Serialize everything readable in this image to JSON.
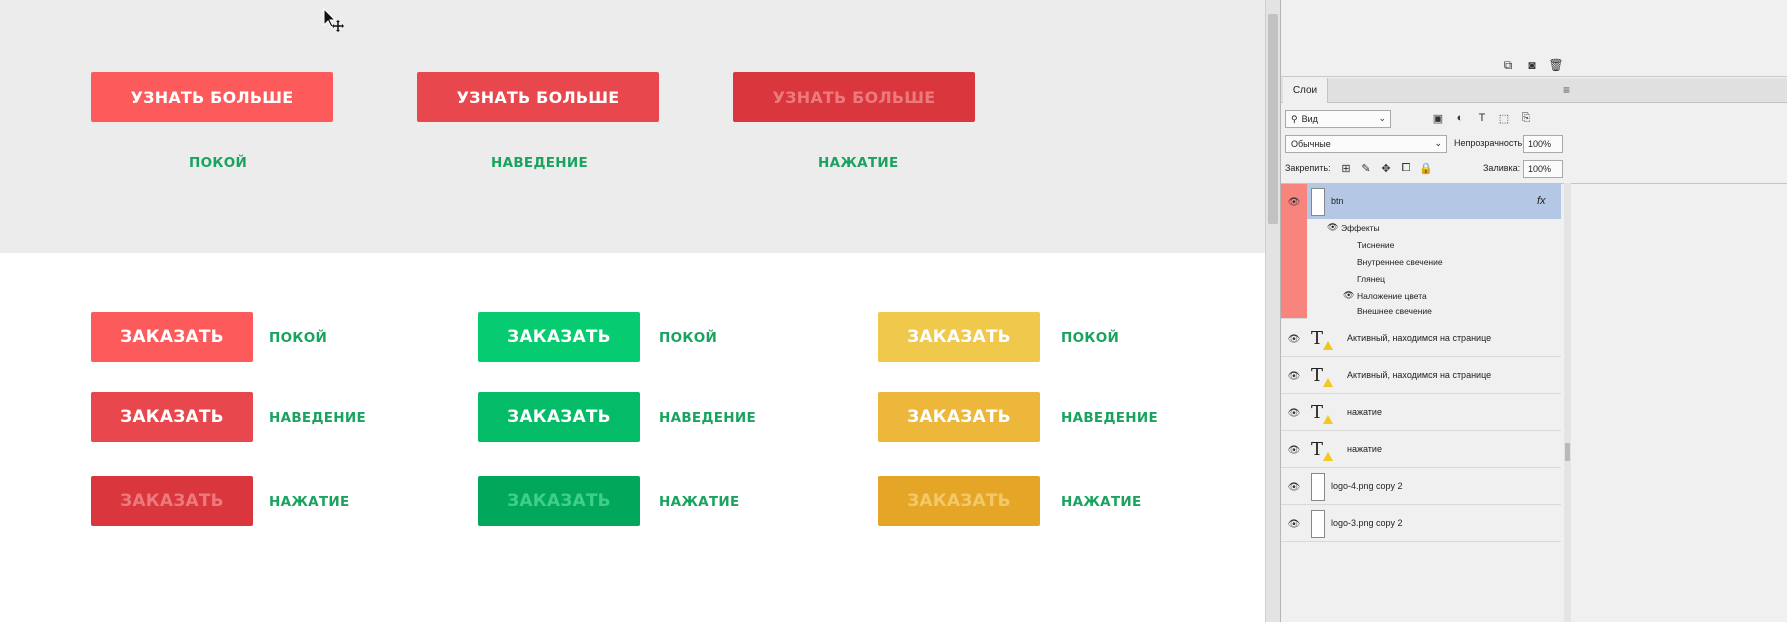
{
  "canvas": {
    "top_buttons": [
      {
        "label": "УЗНАТЬ БОЛЬШЕ",
        "state": "ПОКОЙ",
        "color": "#fd5a5c",
        "text_color": "#ffffff"
      },
      {
        "label": "УЗНАТЬ БОЛЬШЕ",
        "state": "НАВЕДЕНИЕ",
        "color": "#e8474d",
        "text_color": "#ffffff"
      },
      {
        "label": "УЗНАТЬ БОЛЬШЕ",
        "state": "НАЖАТИЕ",
        "color": "#d9363e",
        "text_color": "#ec7a7d"
      }
    ],
    "order_columns": [
      {
        "buttons": [
          {
            "label": "ЗАКАЗАТЬ",
            "state": "ПОКОЙ",
            "color": "#fd5a5c",
            "text_color": "#ffffff"
          },
          {
            "label": "ЗАКАЗАТЬ",
            "state": "НАВЕДЕНИЕ",
            "color": "#e8474d",
            "text_color": "#ffffff"
          },
          {
            "label": "ЗАКАЗАТЬ",
            "state": "НАЖАТИЕ",
            "color": "#d9363e",
            "text_color": "#ec7a7d"
          }
        ]
      },
      {
        "buttons": [
          {
            "label": "ЗАКАЗАТЬ",
            "state": "ПОКОЙ",
            "color": "#06cb71",
            "text_color": "#ffffff"
          },
          {
            "label": "ЗАКАЗАТЬ",
            "state": "НАВЕДЕНИЕ",
            "color": "#04bb67",
            "text_color": "#ffffff"
          },
          {
            "label": "ЗАКАЗАТЬ",
            "state": "НАЖАТИЕ",
            "color": "#01a85c",
            "text_color": "#3fcf8a"
          }
        ]
      },
      {
        "buttons": [
          {
            "label": "ЗАКАЗАТЬ",
            "state": "ПОКОЙ",
            "color": "#f0c84b",
            "text_color": "#ffffff"
          },
          {
            "label": "ЗАКАЗАТЬ",
            "state": "НАВЕДЕНИЕ",
            "color": "#ecb73a",
            "text_color": "#ffffff"
          },
          {
            "label": "ЗАКАЗАТЬ",
            "state": "НАЖАТИЕ",
            "color": "#e5a627",
            "text_color": "#f3c868"
          }
        ]
      }
    ],
    "state_color": "#1aa35f"
  },
  "panel": {
    "tab": "Слои",
    "filter_value": "Вид",
    "blend_mode": "Обычные",
    "opacity_label": "Непрозрачность:",
    "opacity_value": "100%",
    "lock_label": "Закрепить:",
    "fill_label": "Заливка:",
    "fill_value": "100%",
    "selected_layer": {
      "name": "btn",
      "fx": "fx",
      "effects_label": "Эффекты",
      "effects": [
        "Тиснение",
        "Внутреннее свечение",
        "Глянец",
        "Наложение цвета",
        "Внешнее свечение"
      ]
    },
    "layers": [
      {
        "name": "Активный, находимся  на странице",
        "type": "text"
      },
      {
        "name": "Активный, находимся  на странице",
        "type": "text"
      },
      {
        "name": "нажатие",
        "type": "text"
      },
      {
        "name": "нажатие",
        "type": "text"
      },
      {
        "name": "logo-4.png copy 2",
        "type": "image"
      },
      {
        "name": "logo-3.png copy 2",
        "type": "image"
      }
    ]
  }
}
